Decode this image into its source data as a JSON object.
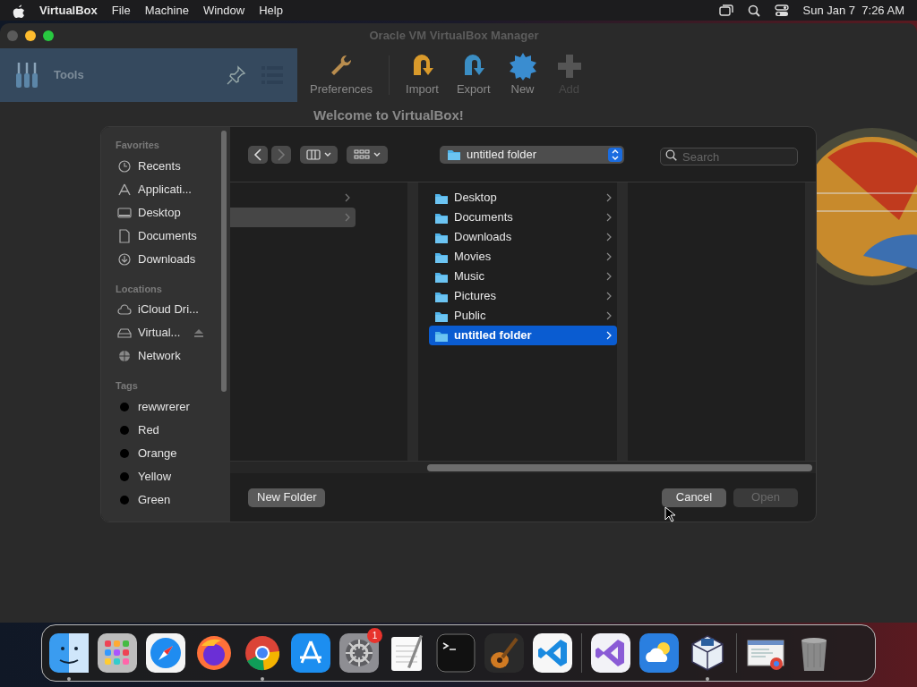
{
  "menubar": {
    "app_name": "VirtualBox",
    "menus": [
      "File",
      "Machine",
      "Window",
      "Help"
    ],
    "clock": "Sun Jan 7  7:26 AM"
  },
  "window": {
    "title": "Oracle VM VirtualBox Manager",
    "tools_label": "Tools",
    "toolbar": [
      {
        "kind": "wrench",
        "label": "Preferences",
        "disabled": false
      },
      {
        "kind": "import",
        "label": "Import",
        "disabled": false
      },
      {
        "kind": "export",
        "label": "Export",
        "disabled": false
      },
      {
        "kind": "new",
        "label": "New",
        "disabled": false
      },
      {
        "kind": "add",
        "label": "Add",
        "disabled": true
      }
    ],
    "welcome": "Welcome to VirtualBox!"
  },
  "dialog": {
    "sidebar": [
      {
        "heading": "Favorites",
        "items": [
          {
            "kind": "clock",
            "label": "Recents"
          },
          {
            "kind": "apps",
            "label": "Applicati..."
          },
          {
            "kind": "desktop",
            "label": "Desktop"
          },
          {
            "kind": "document",
            "label": "Documents"
          },
          {
            "kind": "download",
            "label": "Downloads"
          }
        ]
      },
      {
        "heading": "Locations",
        "items": [
          {
            "kind": "cloud",
            "label": "iCloud Dri..."
          },
          {
            "kind": "disk",
            "label": "Virtual...",
            "ejectable": true
          },
          {
            "kind": "network",
            "label": "Network"
          }
        ]
      },
      {
        "heading": "Tags",
        "items": [
          {
            "kind": "tag",
            "label": "rewwrerer",
            "color": "#000000"
          },
          {
            "kind": "tag",
            "label": "Red",
            "color": "#000000"
          },
          {
            "kind": "tag",
            "label": "Orange",
            "color": "#000000"
          },
          {
            "kind": "tag",
            "label": "Yellow",
            "color": "#000000"
          },
          {
            "kind": "tag",
            "label": "Green",
            "color": "#000000"
          }
        ]
      }
    ],
    "path": "untitled folder",
    "search": {
      "placeholder": "Search"
    },
    "column_1": [
      {
        "selected": false
      },
      {
        "selected": true
      }
    ],
    "column_2": [
      {
        "label": "Desktop",
        "selected": false
      },
      {
        "label": "Documents",
        "selected": false
      },
      {
        "label": "Downloads",
        "selected": false
      },
      {
        "label": "Movies",
        "selected": false
      },
      {
        "label": "Music",
        "selected": false
      },
      {
        "label": "Pictures",
        "selected": false
      },
      {
        "label": "Public",
        "selected": false
      },
      {
        "label": "untitled folder",
        "selected": true
      }
    ],
    "new_folder": "New Folder",
    "buttons": [
      {
        "label": "Cancel",
        "disabled": false
      },
      {
        "label": "Open",
        "disabled": true
      }
    ]
  },
  "dock": [
    {
      "kind": "finder",
      "running": true
    },
    {
      "kind": "launchpad",
      "running": false
    },
    {
      "kind": "safari",
      "running": false
    },
    {
      "kind": "firefox",
      "running": false
    },
    {
      "kind": "chrome",
      "running": true
    },
    {
      "kind": "appstore",
      "running": false
    },
    {
      "kind": "settings",
      "running": false,
      "badge": "1"
    },
    {
      "kind": "textedit",
      "running": false
    },
    {
      "kind": "terminal",
      "running": false
    },
    {
      "kind": "guitar",
      "running": false
    },
    {
      "kind": "vscode",
      "running": false,
      "separator_after": true
    },
    {
      "kind": "vstudio",
      "running": false
    },
    {
      "kind": "weather",
      "running": false
    },
    {
      "kind": "vbox",
      "running": true,
      "separator_after": true
    },
    {
      "kind": "thumb",
      "running": false
    },
    {
      "kind": "trash",
      "running": false
    }
  ]
}
